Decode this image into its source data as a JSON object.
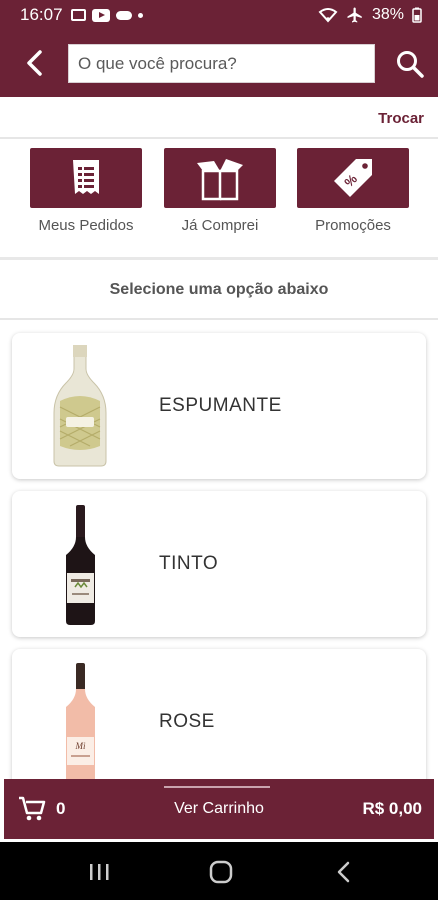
{
  "status_bar": {
    "time": "16:07",
    "battery": "38%"
  },
  "search": {
    "placeholder": "O que você procura?"
  },
  "header": {
    "trocar_label": "Trocar"
  },
  "quick_actions": [
    {
      "label": "Meus Pedidos",
      "icon": "receipt-icon"
    },
    {
      "label": "Já Comprei",
      "icon": "open-box-icon"
    },
    {
      "label": "Promoções",
      "icon": "price-tag-icon"
    }
  ],
  "section_title": "Selecione uma opção abaixo",
  "categories": [
    {
      "label": "ESPUMANTE",
      "icon": "sparkling-bottle-image"
    },
    {
      "label": "TINTO",
      "icon": "red-wine-bottle-image"
    },
    {
      "label": "ROSE",
      "icon": "rose-wine-bottle-image"
    }
  ],
  "cart": {
    "count": "0",
    "view_label": "Ver Carrinho",
    "total": "R$ 0,00"
  },
  "colors": {
    "brand": "#6b2236",
    "text": "#555555"
  }
}
